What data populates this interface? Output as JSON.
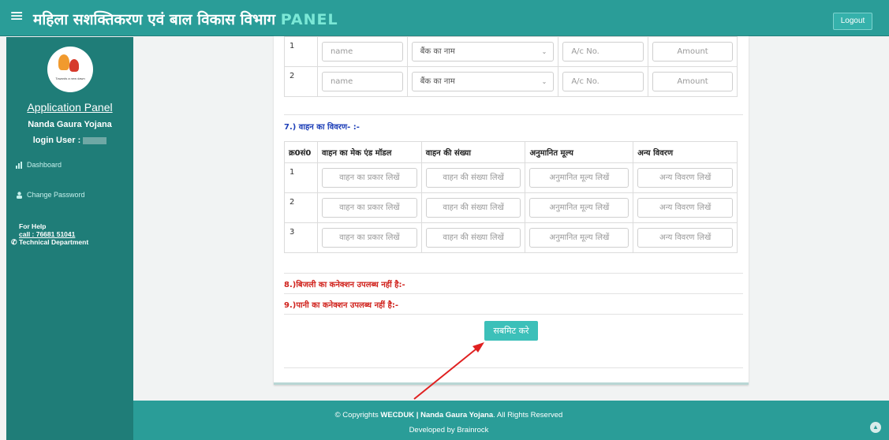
{
  "header": {
    "menu_icon": "≡",
    "title": "महिला सशक्तिकरण एवं बाल विकास विभाग",
    "title_suffix": "PANEL",
    "logout_label": "Logout"
  },
  "sidebar": {
    "logo_caption": "Towards a new dawn",
    "app_panel_label": "Application Panel",
    "scheme_name": "Nanda Gaura Yojana",
    "login_label": "login User :",
    "nav": [
      {
        "label": "Dashboard",
        "icon": "bar-chart-icon"
      },
      {
        "label": "Change Password",
        "icon": "user-icon"
      }
    ],
    "help": {
      "title": "For Help",
      "call": "call : 76681 51041",
      "dept": "Technical Department"
    }
  },
  "bank_table": {
    "rows": [
      {
        "num": "1",
        "name_placeholder": "name",
        "bank_select": "बैंक का नाम",
        "account_placeholder": "A/c No.",
        "amount_placeholder": "Amount"
      },
      {
        "num": "2",
        "name_placeholder": "name",
        "bank_select": "बैंक का नाम",
        "account_placeholder": "A/c No.",
        "amount_placeholder": "Amount"
      }
    ]
  },
  "vehicle_section": {
    "title": "7.) वाहन का विवरण- :-",
    "headers": [
      "क्र0सं0",
      "वाहन का मेक एंड मॉडल",
      "वाहन की संख्या",
      "अनुमानित मूल्य",
      "अन्य विवरण"
    ],
    "rows": [
      {
        "num": "1",
        "p1": "वाहन का प्रकार लिखें",
        "p2": "वाहन की संख्या लिखें",
        "p3": "अनुमानित मूल्य लिखें",
        "p4": "अन्य विवरण लिखें"
      },
      {
        "num": "2",
        "p1": "वाहन का प्रकार लिखें",
        "p2": "वाहन की संख्या लिखें",
        "p3": "अनुमानित मूल्य लिखें",
        "p4": "अन्य विवरण लिखें"
      },
      {
        "num": "3",
        "p1": "वाहन का प्रकार लिखें",
        "p2": "वाहन की संख्या लिखें",
        "p3": "अनुमानित मूल्य लिखें",
        "p4": "अन्य विवरण लिखें"
      }
    ]
  },
  "electricity_label": "8.)बिजली का कनेक्शन उपलब्ध नहीं है:-",
  "water_label": "9.)पानी का कनेक्शन उपलब्ध नहीं है:-",
  "submit_label": "सबमिट करे",
  "footer": {
    "copyright_prefix": "© Copyrights",
    "org": "WECDUK",
    "separator": "|",
    "scheme": "Nanda Gaura Yojana",
    "suffix": ". All Rights Reserved",
    "developed_by": "Developed by Brainrock"
  },
  "colors": {
    "header_bg": "#2a9d98",
    "sidebar_bg": "#1f7d78",
    "section_blue": "#1d3fb8",
    "section_red": "#d0221c",
    "submit_bg": "#3cc0b9",
    "annotation_arrow": "#e02020"
  }
}
